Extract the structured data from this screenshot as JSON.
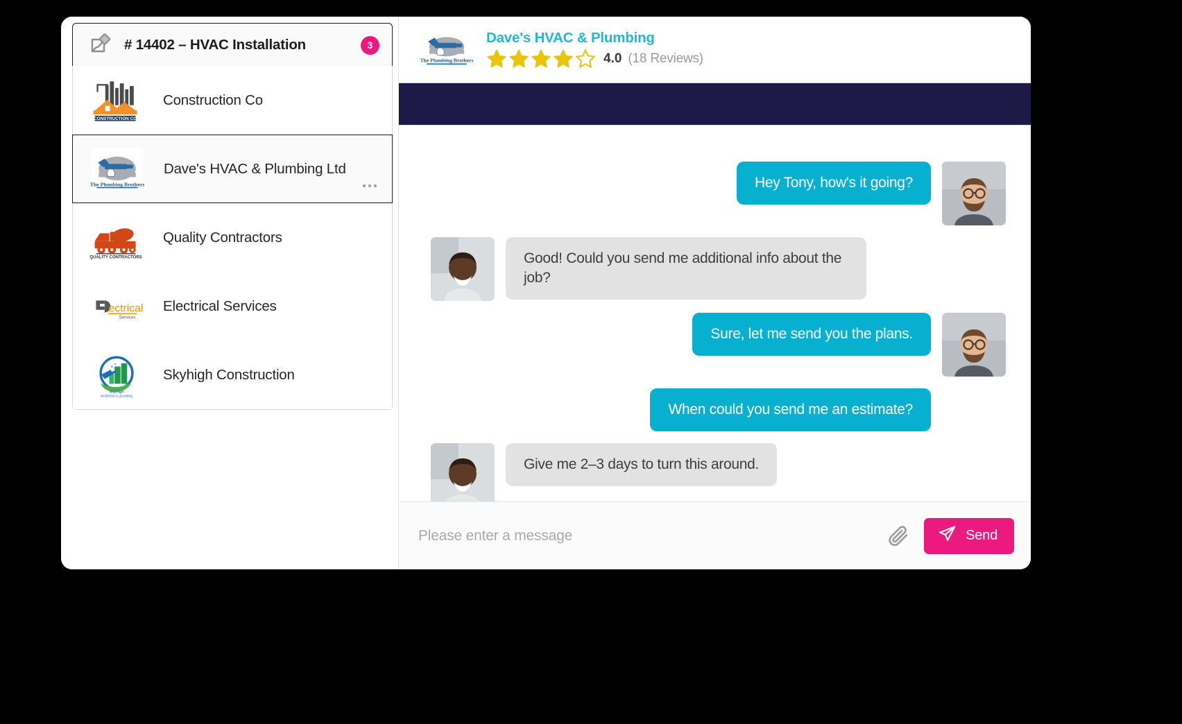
{
  "ticket": {
    "icon": "pin-note-icon",
    "title": "# 14402 – HVAC Installation",
    "badge_count": "3"
  },
  "vendor_list": {
    "items": [
      {
        "name": "Construction Co",
        "logo": "construction-co-logo",
        "selected": false
      },
      {
        "name": "Dave's HVAC & Plumbing Ltd",
        "logo": "plumbing-brothers-logo",
        "selected": true
      },
      {
        "name": "Quality Contractors",
        "logo": "quality-contractors-logo",
        "selected": false
      },
      {
        "name": "Electrical Services",
        "logo": "electrical-services-logo",
        "selected": false
      },
      {
        "name": "Skyhigh Construction",
        "logo": "skyhigh-construction-logo",
        "selected": false
      }
    ],
    "row_menu_icon": "more-options-icon"
  },
  "chat_header": {
    "logo": "plumbing-brothers-logo",
    "vendor_name": "Dave's HVAC & Plumbing",
    "rating_value": "4.0",
    "rating_count": "(18 Reviews)",
    "stars_filled": 4,
    "stars_total": 5
  },
  "messages": [
    {
      "side": "out",
      "text": "Hey Tony, how's it going?",
      "avatar": "avatar-tony"
    },
    {
      "side": "in",
      "text": "Good! Could you send me additional info about the job?",
      "avatar": "avatar-dave"
    },
    {
      "side": "out",
      "text": "Sure, let me send you the plans.",
      "avatar": "avatar-tony"
    },
    {
      "side": "out",
      "text": "When could you send me an estimate?",
      "avatar": null
    },
    {
      "side": "in",
      "text": "Give me 2–3 days to turn this around.",
      "avatar": "avatar-dave"
    }
  ],
  "composer": {
    "placeholder": "Please enter a message",
    "attach_icon": "paperclip-icon",
    "send_icon": "paper-plane-icon",
    "send_label": "Send"
  },
  "colors": {
    "accent_cyan": "#06b0ce",
    "accent_pink": "#ec1a7f",
    "navy_bar": "#1d1a47",
    "star_gold": "#e8c40b",
    "incoming_bubble": "#e2e2e2"
  }
}
